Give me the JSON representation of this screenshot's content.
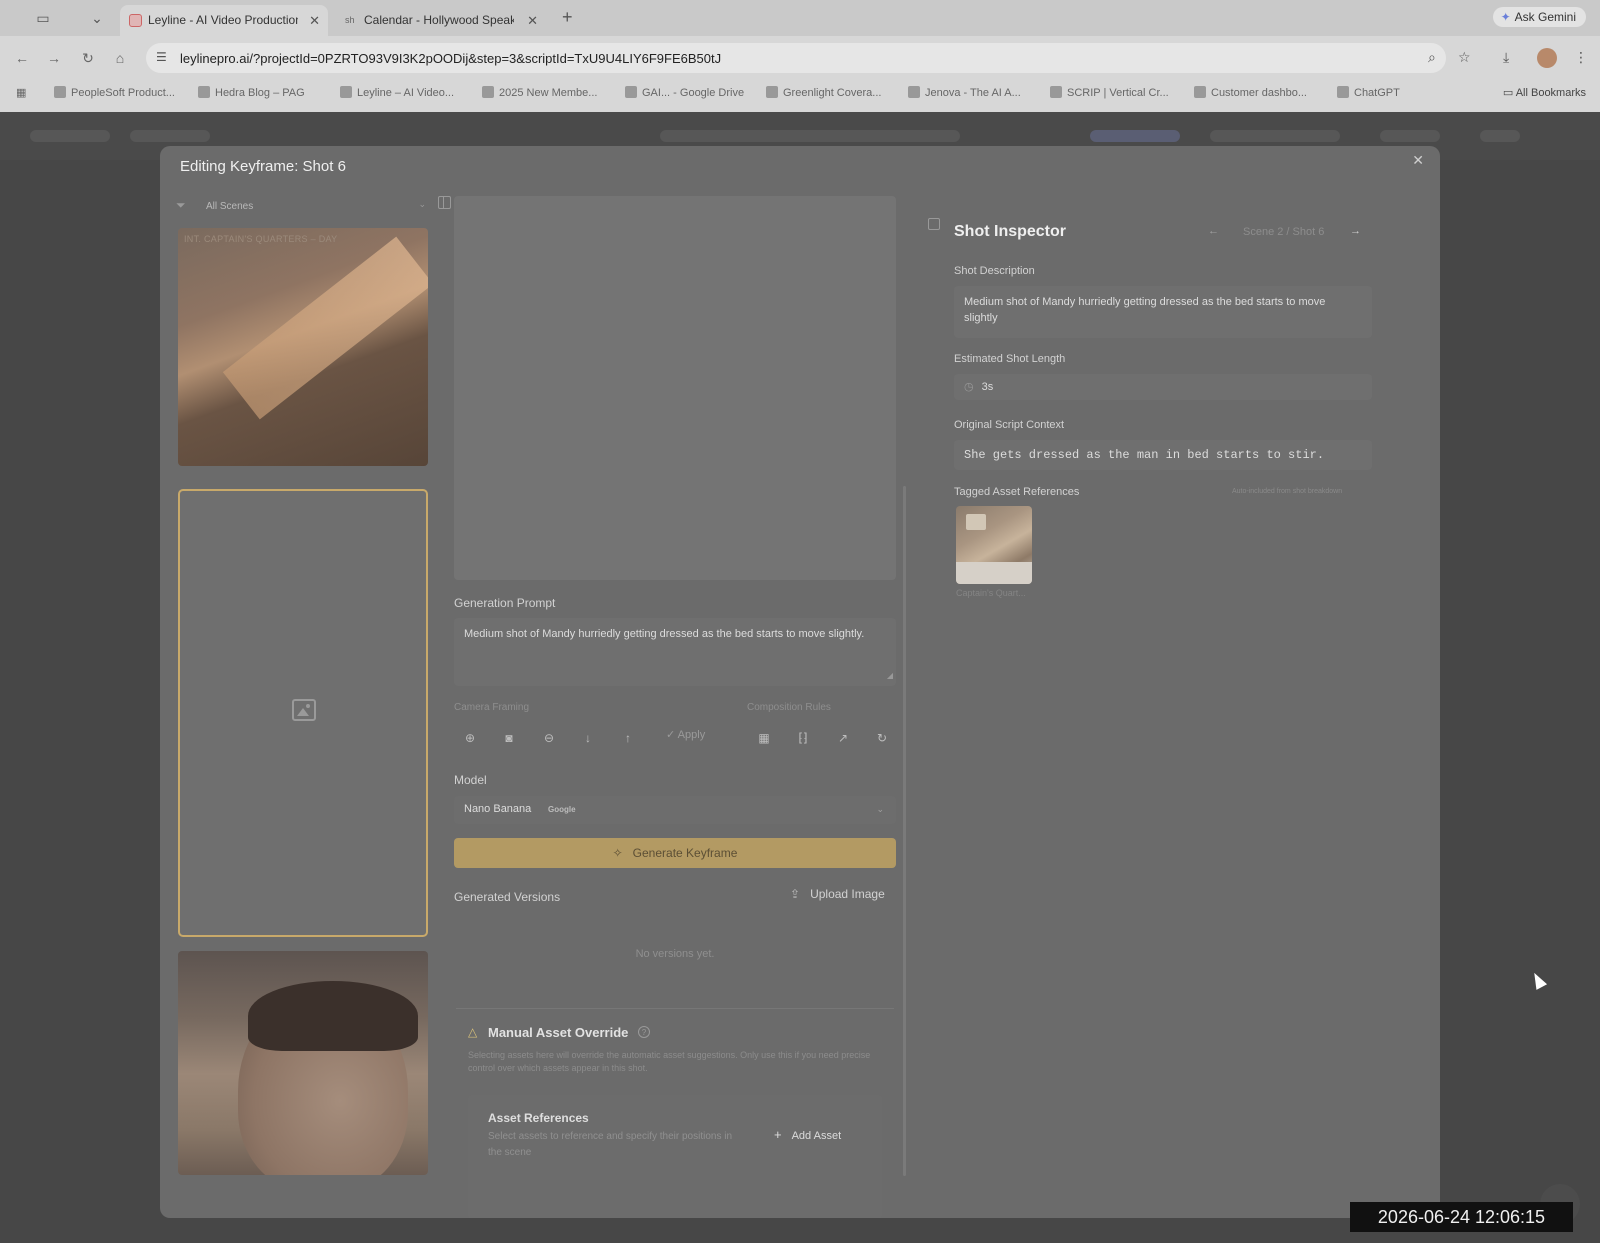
{
  "browser": {
    "tabs": [
      {
        "title": "Leyline - AI Video Production",
        "active": true
      },
      {
        "title": "Calendar - Hollywood Speaker",
        "active": false
      }
    ],
    "ask_gemini": "Ask Gemini",
    "url": "leylinepro.ai/?projectId=0PZRTO93V9I3K2pOODij&step=3&scriptId=TxU9U4LIY6F9FE6B50tJ",
    "bookmarks": [
      "PeopleSoft Product...",
      "Hedra Blog – PAG",
      "Leyline – AI Video...",
      "2025 New Membe...",
      "GAI... - Google Drive",
      "Greenlight Covera...",
      "Jenova - The AI A...",
      "SCRIP | Vertical Cr...",
      "Customer dashbo...",
      "ChatGPT"
    ],
    "all_bookmarks": "All Bookmarks"
  },
  "modal": {
    "title": "Editing Keyframe: Shot 6",
    "scene_filter": "All Scenes",
    "scene_label": "INT. CAPTAIN'S QUARTERS – DAY",
    "generation_prompt_label": "Generation Prompt",
    "generation_prompt": "Medium shot of Mandy hurriedly getting dressed as the bed starts to move slightly.",
    "camera_framing_label": "Camera Framing",
    "composition_rules_label": "Composition Rules",
    "apply_label": "Apply",
    "model_label": "Model",
    "model_name": "Nano Banana",
    "model_vendor": "Google",
    "generate_label": "Generate Keyframe",
    "generated_versions_label": "Generated Versions",
    "upload_label": "Upload Image",
    "no_versions": "No versions yet.",
    "override": {
      "title": "Manual Asset Override",
      "note": "Selecting assets here will override the automatic asset suggestions. Only use this if you need precise control over which assets appear in this shot.",
      "asset_refs_title": "Asset References",
      "asset_refs_sub": "Select assets to reference and specify their positions in the scene",
      "add_asset": "Add Asset"
    }
  },
  "inspector": {
    "title": "Shot Inspector",
    "crumb": "Scene 2 / Shot 6",
    "shot_description_label": "Shot Description",
    "shot_description": "Medium shot of Mandy hurriedly getting dressed as the bed starts to move slightly",
    "shot_length_label": "Estimated Shot Length",
    "shot_length": "3s",
    "script_context_label": "Original Script Context",
    "script_context": "She gets dressed as the man in bed starts to stir.",
    "tagged_refs_label": "Tagged Asset References",
    "tagged_refs_hint": "Auto-included from shot breakdown",
    "tagged_asset_caption": "Captain's Quart..."
  },
  "timestamp": "2026-06-24 12:06:15"
}
